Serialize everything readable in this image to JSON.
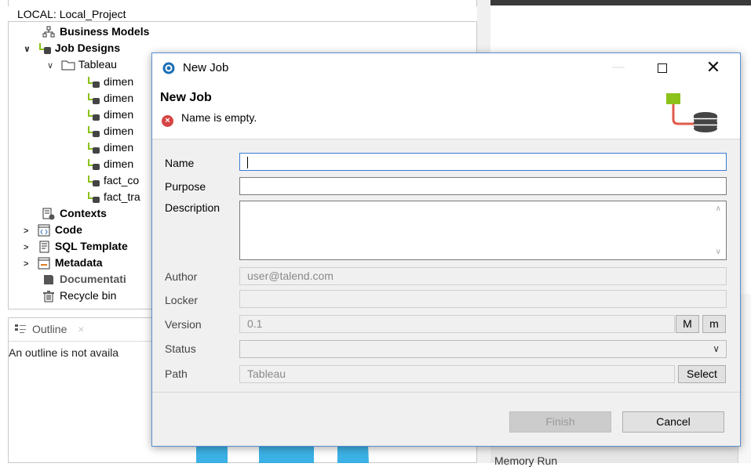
{
  "repository": {
    "header": "LOCAL: Local_Project",
    "items": [
      {
        "label": "Business Models",
        "bold": true,
        "icon": "business-models-icon"
      },
      {
        "label": "Job Designs",
        "bold": true,
        "icon": "job-designs-icon"
      },
      {
        "label": "Tableau",
        "bold": false,
        "icon": "folder-icon"
      },
      {
        "label": "dimen",
        "icon": "job-icon"
      },
      {
        "label": "dimen",
        "icon": "job-icon"
      },
      {
        "label": "dimen",
        "icon": "job-icon"
      },
      {
        "label": "dimen",
        "icon": "job-icon"
      },
      {
        "label": "dimen",
        "icon": "job-icon"
      },
      {
        "label": "dimen",
        "icon": "job-icon"
      },
      {
        "label": "fact_co",
        "icon": "job-icon"
      },
      {
        "label": "fact_tra",
        "icon": "job-icon"
      },
      {
        "label": "Contexts",
        "bold": true,
        "icon": "contexts-icon"
      },
      {
        "label": "Code",
        "bold": true,
        "icon": "code-icon"
      },
      {
        "label": "SQL Template",
        "bold": true,
        "icon": "sql-template-icon"
      },
      {
        "label": "Metadata",
        "bold": true,
        "icon": "metadata-icon"
      },
      {
        "label": "Documentati",
        "bold": true,
        "icon": "documentation-icon"
      },
      {
        "label": "Recycle bin",
        "bold": false,
        "icon": "recycle-bin-icon"
      }
    ]
  },
  "outline": {
    "tab_label": "Outline",
    "message": "An outline is not availa"
  },
  "background": {
    "memory_run": "Memory Run"
  },
  "dialog": {
    "window_title": "New Job",
    "header_title": "New Job",
    "error_message": "Name is empty.",
    "labels": {
      "name": "Name",
      "purpose": "Purpose",
      "description": "Description",
      "author": "Author",
      "locker": "Locker",
      "version": "Version",
      "status": "Status",
      "path": "Path"
    },
    "values": {
      "name": "",
      "purpose": "",
      "description": "",
      "author": "user@talend.com",
      "locker": "",
      "version": "0.1",
      "status": "",
      "path": "Tableau"
    },
    "buttons": {
      "major_version": "M",
      "minor_version": "m",
      "select": "Select",
      "finish": "Finish",
      "cancel": "Cancel"
    },
    "colors": {
      "error": "#d64545",
      "accent_green": "#8cc21a",
      "accent_red": "#e05b4c",
      "focus_blue": "#3a7bd5"
    }
  }
}
